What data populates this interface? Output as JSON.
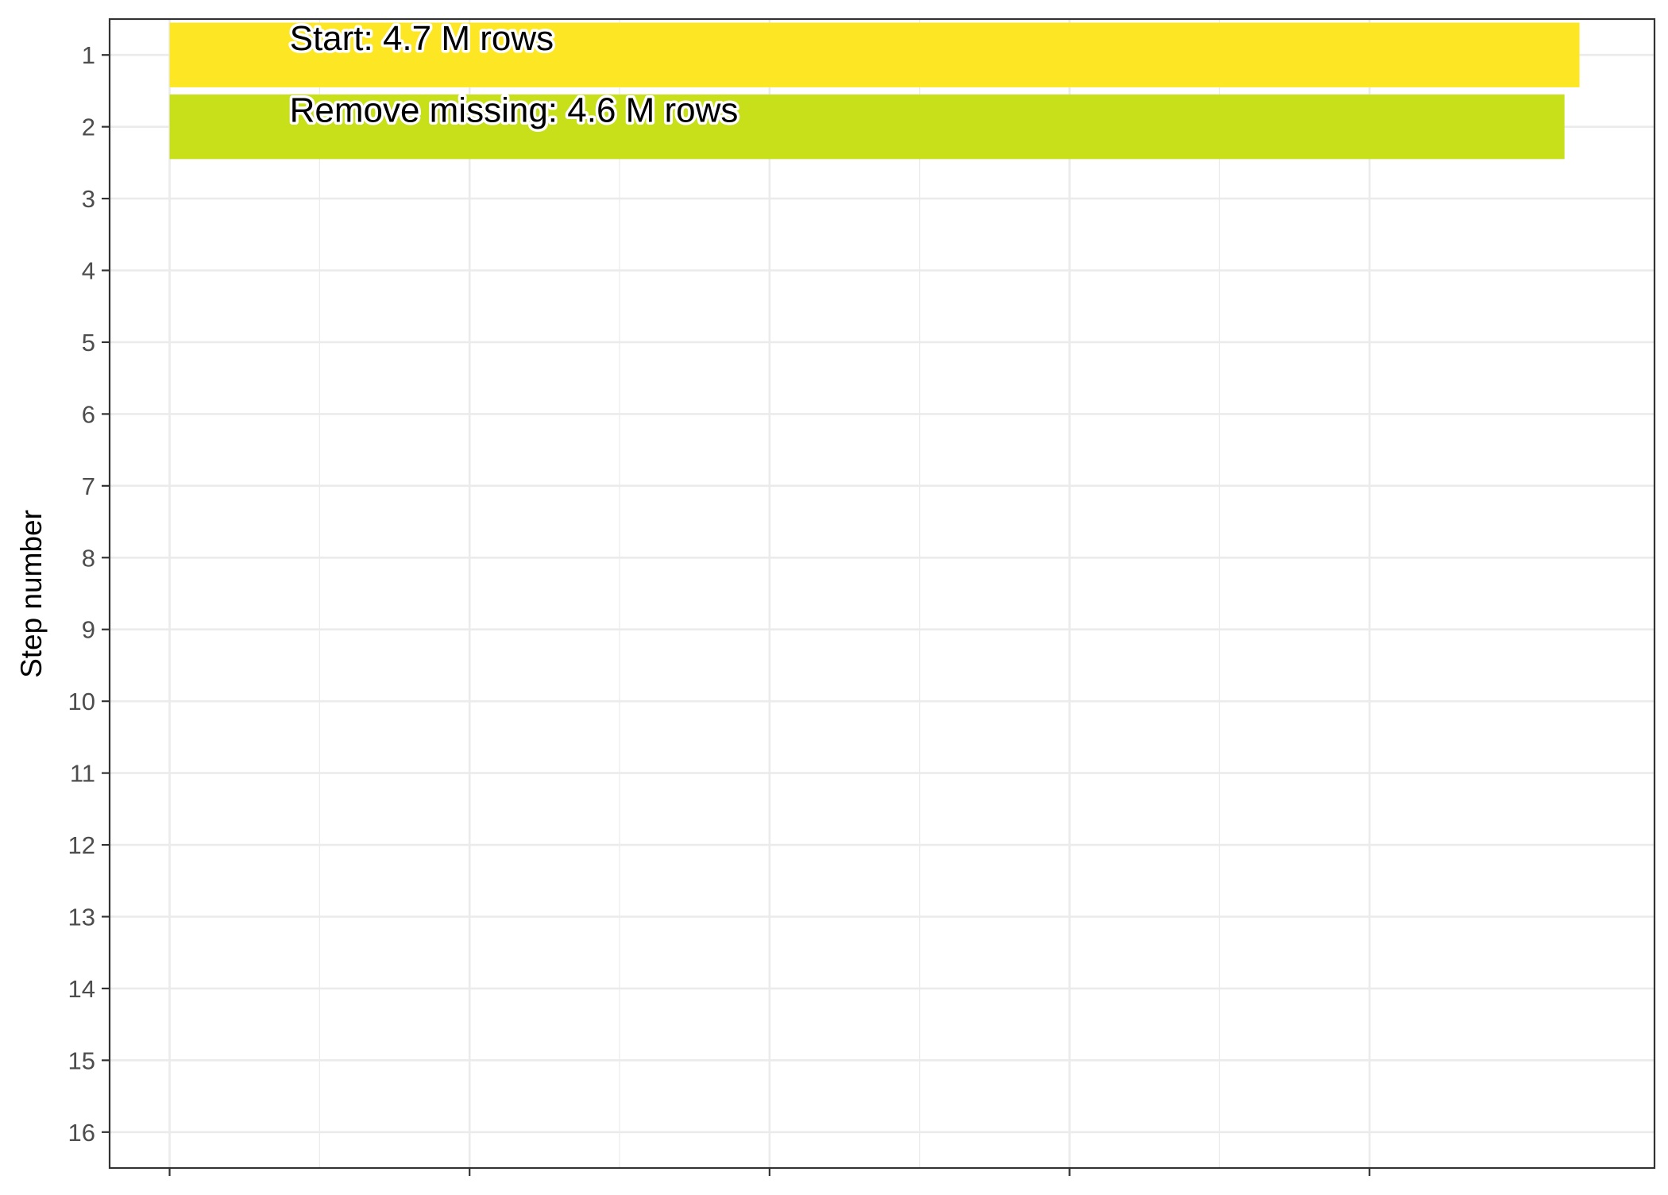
{
  "chart_data": {
    "type": "bar",
    "orientation": "horizontal",
    "ylabel": "Step number",
    "xlabel": "",
    "y_ticks": [
      "1",
      "2",
      "3",
      "4",
      "5",
      "6",
      "7",
      "8",
      "9",
      "10",
      "11",
      "12",
      "13",
      "14",
      "15",
      "16"
    ],
    "ylim": [
      0.5,
      16.5
    ],
    "xlim": [
      -0.2,
      4.95
    ],
    "x_tick_count": 5,
    "grid": true,
    "legend": "none",
    "bars": [
      {
        "step": 1,
        "value": 4.7,
        "label": "Start:  4.7 M rows",
        "color": "#FDE725"
      },
      {
        "step": 2,
        "value": 4.65,
        "label": "Remove missing:  4.6 M rows",
        "color": "#C8E01A"
      }
    ]
  }
}
